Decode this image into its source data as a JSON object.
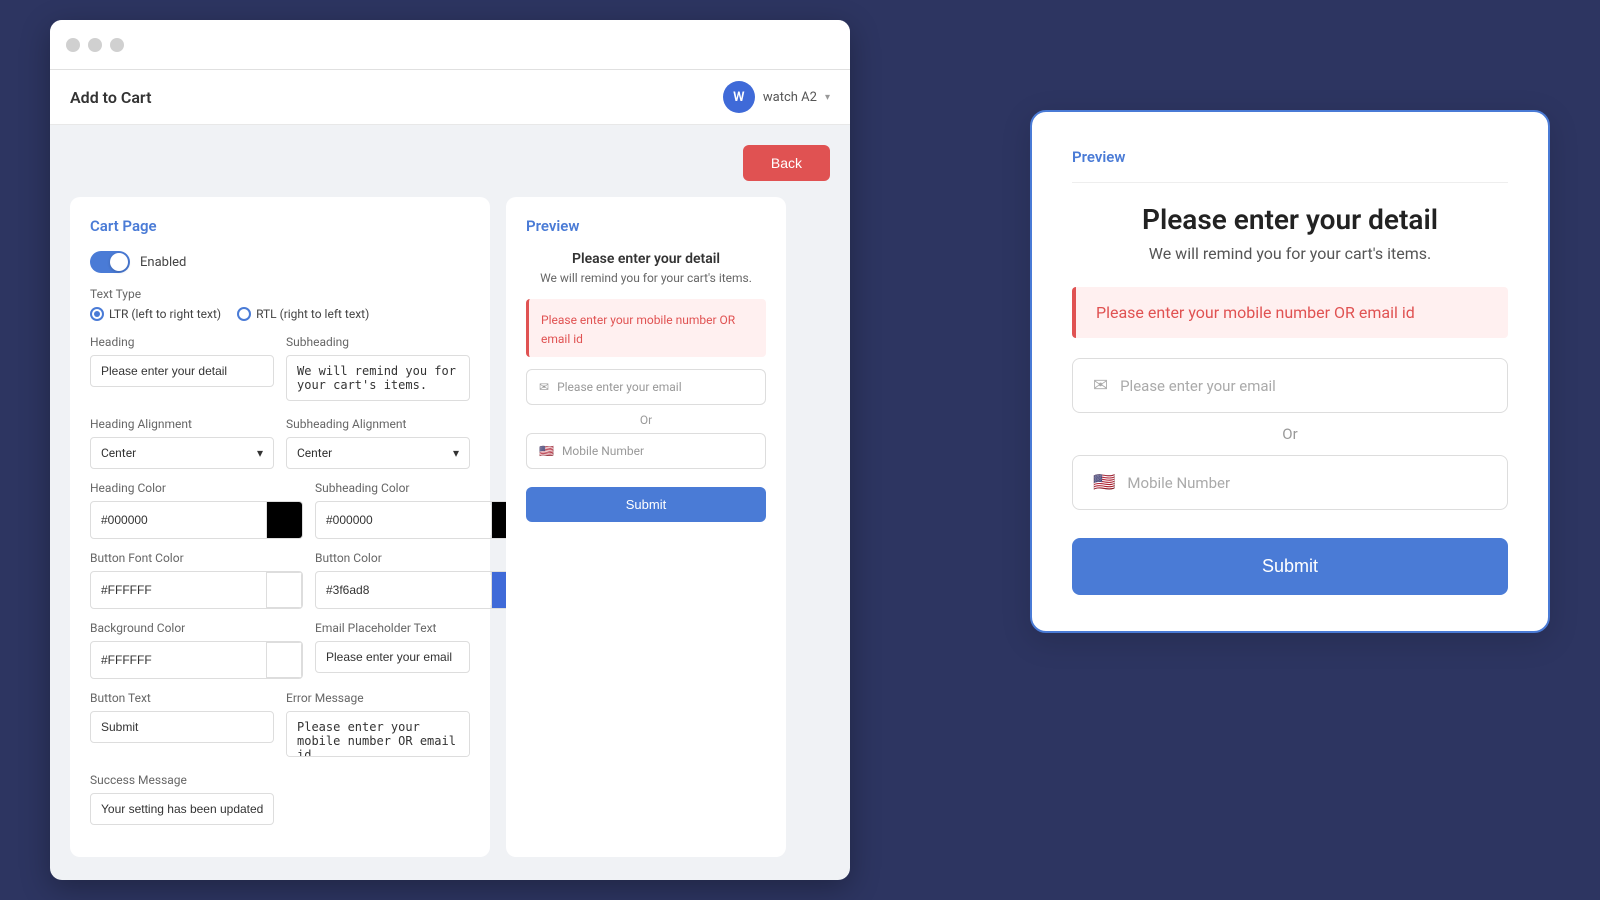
{
  "app": {
    "title": "Add to Cart",
    "user_avatar": "W",
    "user_name": "watch A2"
  },
  "buttons": {
    "back": "Back",
    "submit": "Submit"
  },
  "cart_panel": {
    "title": "Cart Page",
    "enabled_label": "Enabled",
    "text_type_label": "Text Type",
    "ltr_label": "LTR (left to right text)",
    "rtl_label": "RTL (right to left text)",
    "heading_label": "Heading",
    "heading_value": "Please enter your detail",
    "subheading_label": "Subheading",
    "subheading_value": "We will remind you for your cart's items.",
    "heading_alignment_label": "Heading Alignment",
    "heading_alignment_value": "Center",
    "subheading_alignment_label": "Subheading Alignment",
    "subheading_alignment_value": "Center",
    "heading_color_label": "Heading Color",
    "heading_color_value": "#000000",
    "subheading_color_label": "Subheading Color",
    "subheading_color_value": "#000000",
    "button_font_color_label": "Button Font Color",
    "button_font_color_value": "#FFFFFF",
    "button_color_label": "Button Color",
    "button_color_value": "#3f6ad8",
    "background_color_label": "Background Color",
    "background_color_value": "#FFFFFF",
    "email_placeholder_label": "Email Placeholder Text",
    "email_placeholder_value": "Please enter your email",
    "button_text_label": "Button Text",
    "button_text_value": "Submit",
    "error_message_label": "Error Message",
    "error_message_value": "Please enter your mobile number OR email id",
    "success_message_label": "Success Message",
    "success_message_value": "Your setting has been updated"
  },
  "small_preview": {
    "title": "Preview",
    "heading": "Please enter your detail",
    "subheading": "We will remind you for your cart's items.",
    "error_text": "Please enter your mobile number OR email id",
    "email_placeholder": "Please enter your email",
    "or_text": "Or",
    "mobile_placeholder": "Mobile Number",
    "submit_label": "Submit"
  },
  "large_preview": {
    "title": "Preview",
    "heading": "Please enter your detail",
    "subheading": "We will remind you for your cart's items.",
    "error_text": "Please enter your mobile number OR email id",
    "email_placeholder": "Please enter your email",
    "or_text": "Or",
    "mobile_placeholder": "Mobile Number",
    "submit_label": "Submit"
  }
}
